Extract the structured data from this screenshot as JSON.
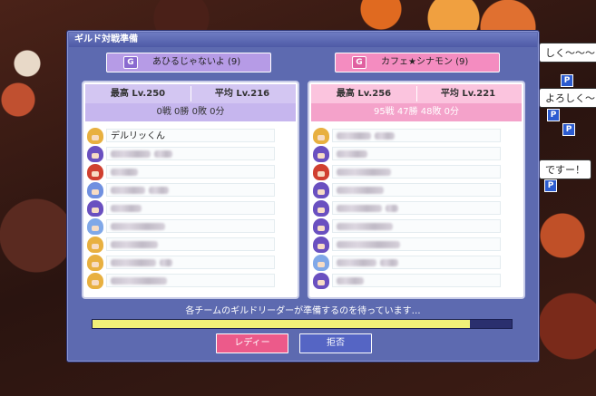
{
  "window": {
    "title": "ギルド対戦準備"
  },
  "background_chat": [
    "しく〜〜〜",
    "よろしく〜",
    "ですー！"
  ],
  "teams": [
    {
      "tag_icon": "G",
      "name": "あひるじゃないよ (9)",
      "max_level": "最高 Lv.250",
      "avg_level": "平均 Lv.216",
      "record": "0戦 0勝 0敗 0分",
      "members": [
        {
          "name": "デルリッくん",
          "avatar_color": "#e8b040"
        },
        {
          "name": "",
          "avatar_color": "#6a50c0"
        },
        {
          "name": "",
          "avatar_color": "#d04030"
        },
        {
          "name": "",
          "avatar_color": "#7090e0"
        },
        {
          "name": "",
          "avatar_color": "#6a50c0"
        },
        {
          "name": "",
          "avatar_color": "#80a8e8"
        },
        {
          "name": "",
          "avatar_color": "#e8b040"
        },
        {
          "name": "",
          "avatar_color": "#e8b040"
        },
        {
          "name": "",
          "avatar_color": "#e8b040"
        }
      ]
    },
    {
      "tag_icon": "G",
      "name": "カフェ★シナモン (9)",
      "max_level": "最高 Lv.256",
      "avg_level": "平均 Lv.221",
      "record": "95戦 47勝 48敗 0分",
      "members": [
        {
          "name": "",
          "avatar_color": "#e8b040"
        },
        {
          "name": "",
          "avatar_color": "#6a50c0"
        },
        {
          "name": "",
          "avatar_color": "#d04030"
        },
        {
          "name": "",
          "avatar_color": "#6a50c0"
        },
        {
          "name": "",
          "avatar_color": "#6a50c0"
        },
        {
          "name": "",
          "avatar_color": "#6a50c0"
        },
        {
          "name": "",
          "avatar_color": "#6a50c0"
        },
        {
          "name": "",
          "avatar_color": "#80a8e8"
        },
        {
          "name": "",
          "avatar_color": "#6a50c0"
        }
      ]
    }
  ],
  "status_text": "各チームのギルドリーダーが準備するのを待っています…",
  "progress": 0.9,
  "buttons": {
    "ready": "レディー",
    "decline": "拒否"
  },
  "colors": {
    "window": "#5d6ab0",
    "ready": "#ec5a8a",
    "decline": "#5565c4",
    "progress_fill": "#f0f078"
  }
}
